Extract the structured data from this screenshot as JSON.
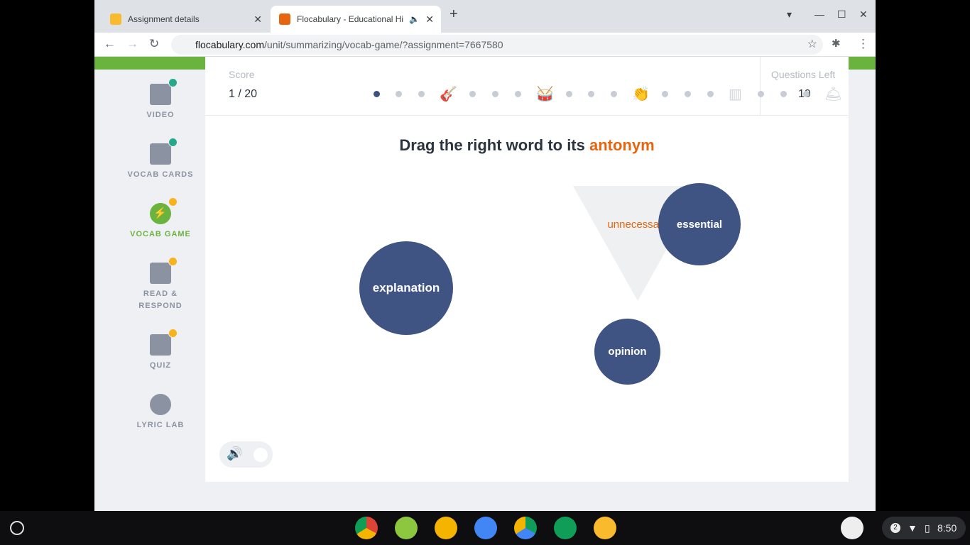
{
  "browser": {
    "tabs": [
      {
        "title": "Assignment details"
      },
      {
        "title": "Flocabulary - Educational Hi"
      }
    ],
    "url_domain": "flocabulary.com",
    "url_path": "/unit/summarizing/vocab-game/?assignment=7667580"
  },
  "sidebar": {
    "items": [
      {
        "label": "VIDEO",
        "status": "done"
      },
      {
        "label": "VOCAB CARDS",
        "status": "done"
      },
      {
        "label": "VOCAB GAME",
        "status": "active"
      },
      {
        "label": "READ & RESPOND",
        "status": "pending"
      },
      {
        "label": "QUIZ",
        "status": "pending"
      },
      {
        "label": "LYRIC LAB",
        "status": "none"
      }
    ]
  },
  "score": {
    "label": "Score",
    "value": "1 / 20",
    "progress_current": 1,
    "progress_total": 20
  },
  "questions_left": {
    "label": "Questions Left",
    "value": "19"
  },
  "game": {
    "prompt": "Drag the right word to its ",
    "prompt_highlight": "antonym",
    "target_word": "unnecessary",
    "choices": [
      "explanation",
      "essential",
      "opinion"
    ]
  },
  "colors": {
    "accent": "#e8650f",
    "bubble": "#3f5482",
    "green": "#6bb33f"
  },
  "tray": {
    "notifications": "2",
    "time": "8:50"
  }
}
